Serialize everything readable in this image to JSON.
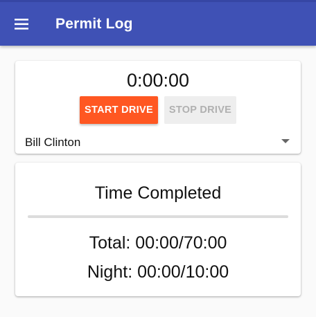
{
  "app": {
    "title": "Permit Log",
    "menu_icon": "hamburger-menu-icon",
    "primary_color": "#3f51b5",
    "accent_color": "#ff5722"
  },
  "timer": {
    "elapsed": "0:00:00",
    "start_label": "START DRIVE",
    "stop_label": "STOP DRIVE",
    "stop_enabled": false
  },
  "driver": {
    "selected": "Bill Clinton",
    "dropdown_icon": "caret-down-icon"
  },
  "progress": {
    "title": "Time Completed",
    "fraction": 0,
    "total_label": "Total: 00:00/70:00",
    "night_label": "Night: 00:00/10:00"
  }
}
